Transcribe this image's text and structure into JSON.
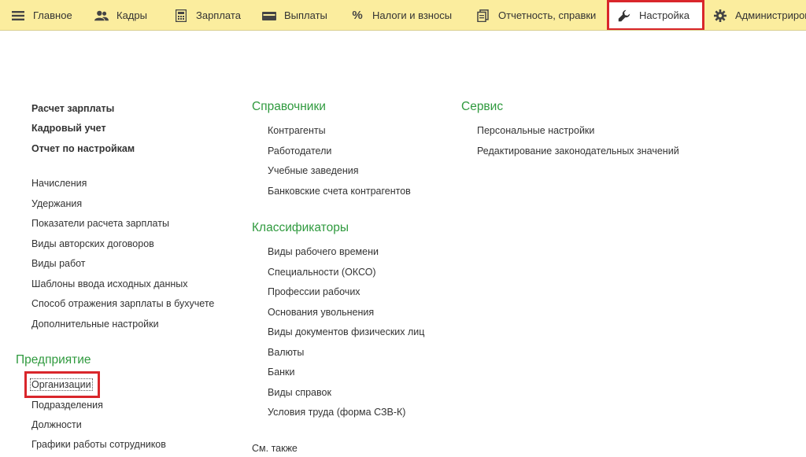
{
  "sections": [
    {
      "id": "main",
      "label": "Главное",
      "icon": "hamburger-icon"
    },
    {
      "id": "hr",
      "label": "Кадры",
      "icon": "users-icon"
    },
    {
      "id": "salary",
      "label": "Зарплата",
      "icon": "calculator-icon"
    },
    {
      "id": "payments",
      "label": "Выплаты",
      "icon": "wallet-icon"
    },
    {
      "id": "taxes",
      "label": "Налоги и взносы",
      "icon": "percent-icon"
    },
    {
      "id": "reports",
      "label": "Отчетность, справки",
      "icon": "documents-icon"
    },
    {
      "id": "settings",
      "label": "Настройка",
      "icon": "wrench-icon",
      "active": true
    },
    {
      "id": "admin",
      "label": "Администриров",
      "icon": "gear-icon"
    }
  ],
  "column1": {
    "top_links": [
      "Расчет зарплаты",
      "Кадровый учет",
      "Отчет по настройкам"
    ],
    "links": [
      "Начисления",
      "Удержания",
      "Показатели расчета зарплаты",
      "Виды авторских договоров",
      "Виды работ",
      "Шаблоны ввода исходных данных",
      "Способ отражения зарплаты в бухучете",
      "Дополнительные настройки"
    ],
    "enterprise": {
      "title": "Предприятие",
      "links": [
        "Организации",
        "Подразделения",
        "Должности",
        "Графики работы сотрудников"
      ]
    }
  },
  "column2": {
    "directories": {
      "title": "Справочники",
      "links": [
        "Контрагенты",
        "Работодатели",
        "Учебные заведения",
        "Банковские счета контрагентов"
      ]
    },
    "classifiers": {
      "title": "Классификаторы",
      "links": [
        "Виды рабочего времени",
        "Специальности (ОКСО)",
        "Профессии рабочих",
        "Основания увольнения",
        "Виды документов физических лиц",
        "Валюты",
        "Банки",
        "Виды справок",
        "Условия труда (форма СЗВ-К)"
      ]
    },
    "see_also": "См. также"
  },
  "column3": {
    "service": {
      "title": "Сервис",
      "links": [
        "Персональные настройки",
        "Редактирование законодательных значений"
      ]
    }
  },
  "colors": {
    "topbar": "#fbed9e",
    "section_header": "#2f9a3e",
    "highlight": "#d9262b"
  }
}
